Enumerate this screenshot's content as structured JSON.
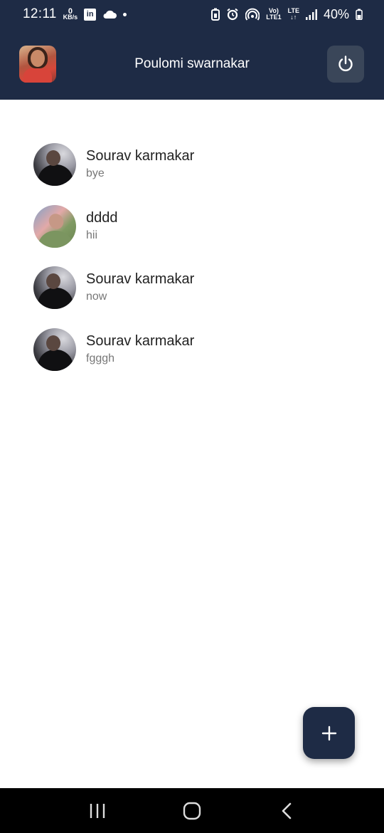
{
  "status_bar": {
    "time": "12:11",
    "net_speed_value": "0",
    "net_speed_unit": "KB/s",
    "linkedin_label": "in",
    "volte_top": "Vo)",
    "volte_bottom": "LTE1",
    "lte_top": "LTE",
    "lte_bottom": "↓↑",
    "battery": "40%"
  },
  "header": {
    "title": "Poulomi swarnakar"
  },
  "chats": [
    {
      "name": "Sourav karmakar",
      "preview": "bye"
    },
    {
      "name": "dddd",
      "preview": "hii"
    },
    {
      "name": "Sourav karmakar",
      "preview": "now"
    },
    {
      "name": "Sourav karmakar",
      "preview": "fgggh"
    }
  ],
  "colors": {
    "header_bg": "#1e2b45",
    "power_button_bg": "#3a4659",
    "fab_bg": "#1e2b45",
    "nav_bg": "#000000"
  },
  "icons": {
    "power": "power-icon",
    "fab": "plus-icon",
    "nav_recent": "recent-apps-icon",
    "nav_home": "home-icon",
    "nav_back": "back-icon"
  }
}
